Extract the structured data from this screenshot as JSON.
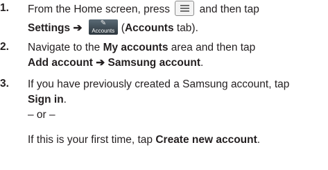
{
  "steps": [
    {
      "number": "1.",
      "line1_pre": "From the Home screen, press",
      "line1_post": "and then tap",
      "line2_a": "Settings",
      "line2_arrow": "➔",
      "line2_tab_label": "Accounts",
      "line2_b_open": "(",
      "line2_b_bold": "Accounts",
      "line2_b_close": " tab)."
    },
    {
      "number": "2.",
      "line1_pre": "Navigate to the",
      "line1_bold": "My accounts",
      "line1_post": "area and then tap",
      "line2_a": "Add account",
      "line2_arrow": "➔",
      "line2_b": "Samsung account",
      "line2_end": "."
    },
    {
      "number": "3.",
      "line1": "If you have previously created a Samsung account, tap",
      "line2_bold": "Sign in",
      "line2_end": ".",
      "or_text": "– or –",
      "line4_pre": "If this is your first time, tap",
      "line4_bold": "Create new account",
      "line4_end": "."
    }
  ],
  "icons": {
    "menu_key": "menu-key-icon",
    "accounts_tab": "key-icon"
  }
}
